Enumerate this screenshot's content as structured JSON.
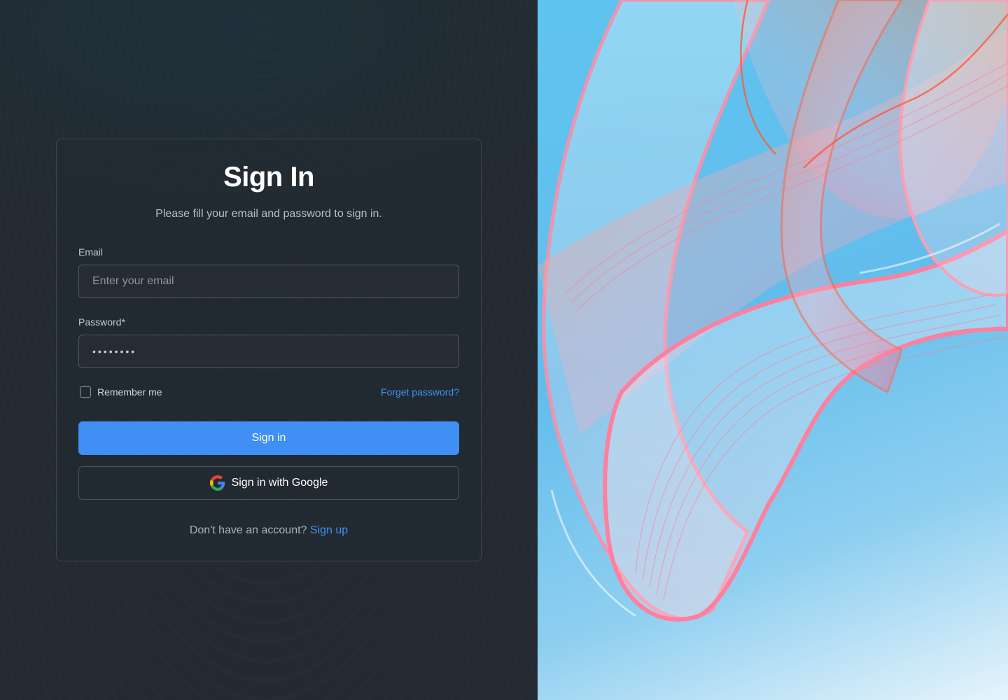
{
  "signin": {
    "title": "Sign In",
    "subtitle": "Please fill your email and password to sign in.",
    "email_label": "Email",
    "email_placeholder": "Enter your email",
    "password_label": "Password*",
    "password_value": "••••••••",
    "remember_label": "Remember me",
    "remember_checked": false,
    "forgot_label": "Forget password?",
    "signin_button": "Sign in",
    "google_button": "Sign in with Google",
    "no_account_text": "Don't have an account?",
    "signup_link": "Sign up"
  },
  "icons": {
    "google": "google-icon"
  },
  "colors": {
    "background": "#232a31",
    "primary": "#3f8ff5",
    "link": "#3f93f0",
    "card_border": "#3e4650"
  }
}
